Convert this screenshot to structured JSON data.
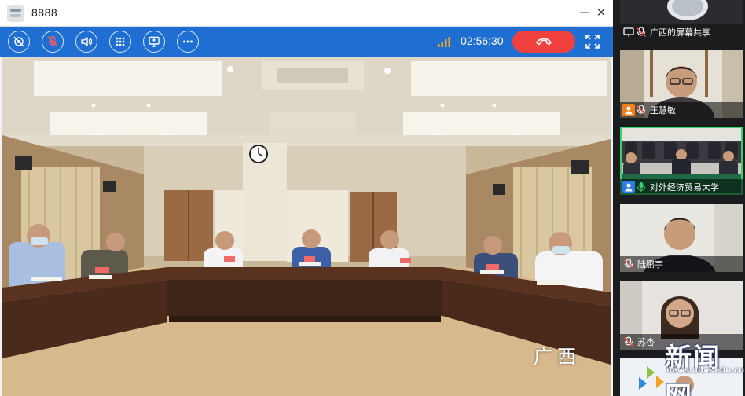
{
  "window": {
    "title": "8888",
    "minimize_label": "—",
    "close_label": "✕"
  },
  "toolbar": {
    "buttons": [
      {
        "icon": "camera-off-icon"
      },
      {
        "icon": "mic-muted-icon"
      },
      {
        "icon": "speaker-icon"
      },
      {
        "icon": "grid-icon"
      },
      {
        "icon": "screen-share-icon"
      },
      {
        "icon": "more-icon"
      }
    ],
    "signal_icon": "signal-strength-icon",
    "timer": "02:56:30",
    "hangup_icon": "hang-up-icon",
    "fullscreen_icon": "fullscreen-icon",
    "colors": {
      "bar": "#1f6fd2",
      "hangup": "#f0413f"
    }
  },
  "main_video": {
    "location_label": "广西"
  },
  "participants": [
    {
      "name": "广西的屏幕共享",
      "status_icons": [
        "screen-share-icon",
        "mic-muted-icon"
      ]
    },
    {
      "name": "王慧敏",
      "status_icons": [
        "user-role-icon",
        "mic-muted-icon"
      ]
    },
    {
      "name": "对外经济贸易大学",
      "status_icons": [
        "user-role-icon",
        "mic-active-icon"
      ],
      "active": true
    },
    {
      "name": "陆鹏宇",
      "status_icons": [
        "mic-muted-icon"
      ]
    },
    {
      "name": "苏杏",
      "status_icons": [
        "mic-muted-icon"
      ]
    }
  ],
  "watermark": {
    "text": "新闻网",
    "url": "news.uibe.edu.cn"
  }
}
